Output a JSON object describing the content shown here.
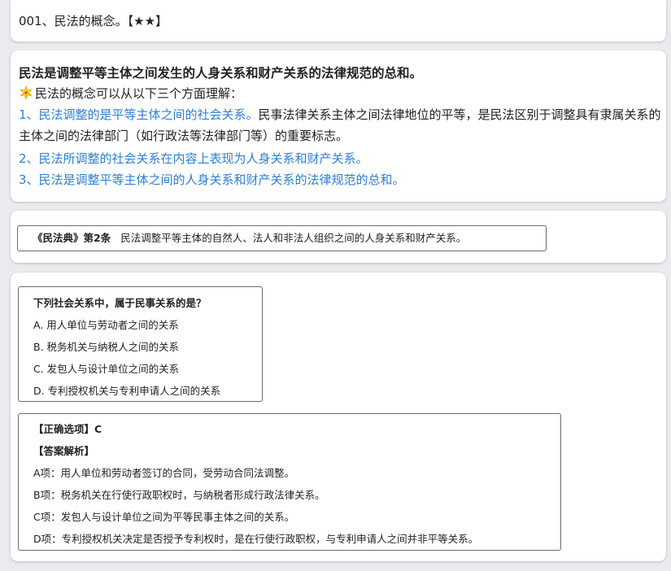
{
  "title_card": {
    "heading": "001、民法的概念。【★★】"
  },
  "concept_card": {
    "definition": "民法是调整平等主体之间发生的人身关系和财产关系的法律规范的总和。",
    "intro_icon": "sparkle-star-icon",
    "intro": "民法的概念可以从以下三个方面理解：",
    "point1_blue": "1、民法调整的是平等主体之间的社会关系。",
    "point1_rest": "民事法律关系主体之间法律地位的平等，是民法区别于调整具有隶属关系的主体之间的法律部门（如行政法等法律部门等）的重要标志。",
    "point2": "2、民法所调整的社会关系在内容上表现为人身关系和财产关系。",
    "point3": "3、民法是调整平等主体之间的人身关系和财产关系的法律规范的总和。",
    "accent_color": "#2f7fd1"
  },
  "law_card": {
    "source": "《民法典》第2条",
    "text": "民法调整平等主体的自然人、法人和非法人组织之间的人身关系和财产关系。"
  },
  "quiz_card": {
    "question": "下列社会关系中，属于民事关系的是？",
    "options": [
      "A. 用人单位与劳动者之间的关系",
      "B. 税务机关与纳税人之间的关系",
      "C. 发包人与设计单位之间的关系",
      "D. 专利授权机关与专利申请人之间的关系"
    ],
    "answer_label": "【正确选项】C",
    "analysis_label": "【答案解析】",
    "analysis": [
      "A项：用人单位和劳动者签订的合同，受劳动合同法调整。",
      "B项：税务机关在行使行政职权时，与纳税者形成行政法律关系。",
      "C项：发包人与设计单位之间为平等民事主体之间的关系。",
      "D项：专利授权机关决定是否授予专利权时，是在行使行政职权，与专利申请人之间并非平等关系。"
    ]
  }
}
